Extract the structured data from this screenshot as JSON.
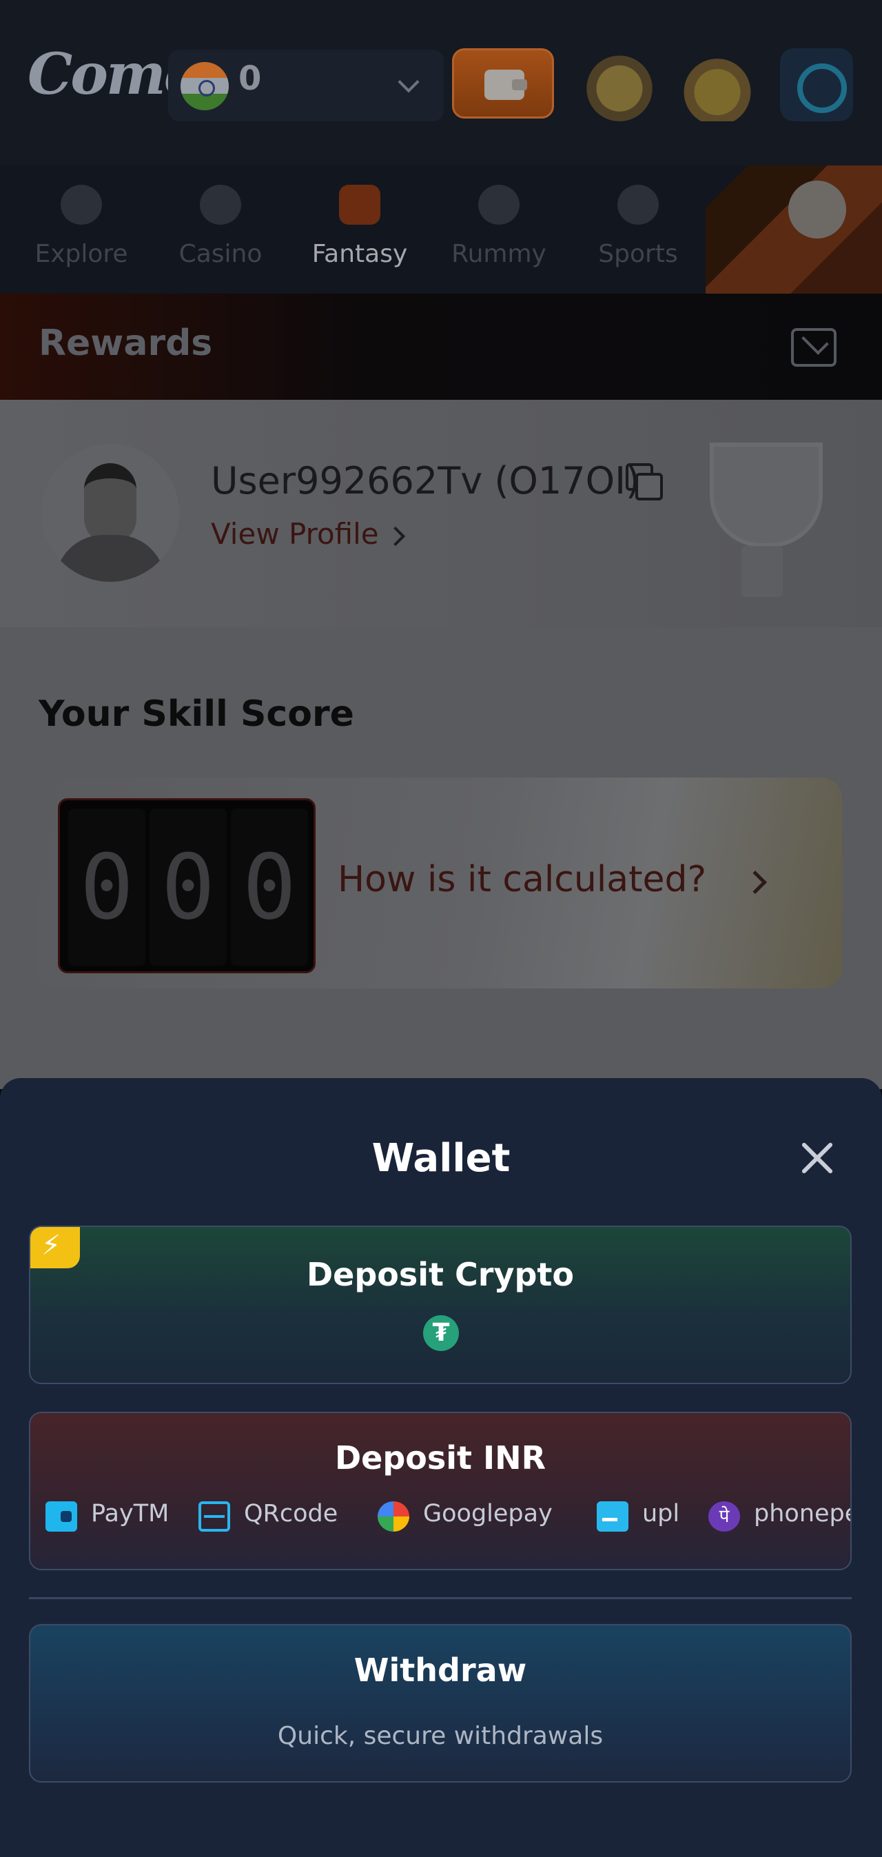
{
  "header": {
    "logo_text": "Come",
    "balance": "0",
    "icons": [
      "wallet-icon",
      "treasure-pot-icon",
      "treasure-chest-icon",
      "support-icon"
    ]
  },
  "nav": {
    "items": [
      {
        "label": "Explore",
        "icon": "planet-icon"
      },
      {
        "label": "Casino",
        "icon": "spade-icon"
      },
      {
        "label": "Fantasy",
        "icon": "cricket-bat-icon",
        "active": true
      },
      {
        "label": "Rummy",
        "icon": "cards-icon"
      },
      {
        "label": "Sports",
        "icon": "football-icon"
      }
    ]
  },
  "rewards": {
    "title": "Rewards"
  },
  "profile": {
    "username": "User992662Tv (O17OI)",
    "view_profile": "View Profile"
  },
  "skill": {
    "title": "Your Skill Score",
    "digits": [
      "0",
      "0",
      "0"
    ],
    "how_calculated": "How is it calculated?"
  },
  "wallet": {
    "title": "Wallet",
    "deposit_crypto": {
      "title": "Deposit Crypto",
      "coin_symbol": "₮"
    },
    "deposit_inr": {
      "title": "Deposit INR",
      "methods": [
        {
          "label": "PayTM",
          "icon": "paytm-icon"
        },
        {
          "label": "QRcode",
          "icon": "qrcode-icon"
        },
        {
          "label": "Googlepay",
          "icon": "googlepay-icon"
        },
        {
          "label": "upl",
          "icon": "upi-icon"
        },
        {
          "label": "phonepe",
          "icon": "phonepe-icon",
          "glyph": "पे"
        }
      ]
    },
    "withdraw": {
      "title": "Withdraw",
      "subtitle": "Quick, secure withdrawals"
    }
  },
  "colors": {
    "sheet_bg": "#1a2439",
    "crypto_accent": "#1c4639",
    "inr_accent": "#472429",
    "withdraw_accent": "#1a4360",
    "tether_green": "#27a17a",
    "bolt_yellow": "#f2c114"
  }
}
